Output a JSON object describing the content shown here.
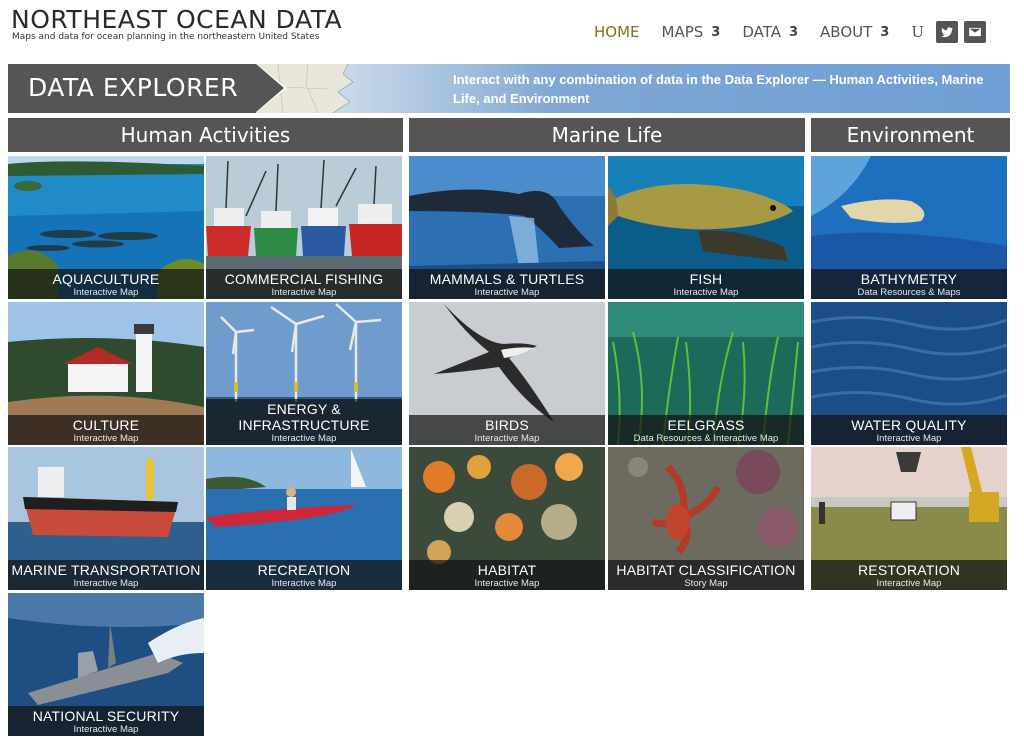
{
  "header": {
    "site_title": "NORTHEAST OCEAN DATA",
    "tagline": "Maps and data for ocean planning in the northeastern United States",
    "nav": [
      {
        "label": "HOME",
        "count": ""
      },
      {
        "label": "MAPS",
        "count": "3"
      },
      {
        "label": "DATA",
        "count": "3"
      },
      {
        "label": "ABOUT",
        "count": "3"
      }
    ],
    "user_glyph": "U",
    "social": [
      "twitter-icon",
      "email-icon"
    ]
  },
  "banner": {
    "title": "DATA EXPLORER",
    "description": "Interact with any combination of data in the Data Explorer — Human Activities, Marine Life, and Environment"
  },
  "categories": [
    "Human Activities",
    "Marine Life",
    "Environment"
  ],
  "tiles": [
    {
      "title": "AQUACULTURE",
      "subtitle": "Interactive Map"
    },
    {
      "title": "COMMERCIAL FISHING",
      "subtitle": "Interactive Map"
    },
    {
      "title": "MAMMALS & TURTLES",
      "subtitle": "Interactive Map"
    },
    {
      "title": "FISH",
      "subtitle": "Interactive Map"
    },
    {
      "title": "BATHYMETRY",
      "subtitle": "Data Resources & Maps"
    },
    {
      "title": "CULTURE",
      "subtitle": "Interactive Map"
    },
    {
      "title": "ENERGY &",
      "title2": "INFRASTRUCTURE",
      "subtitle": "Interactive Map"
    },
    {
      "title": "BIRDS",
      "subtitle": "Interactive Map"
    },
    {
      "title": "EELGRASS",
      "subtitle": "Data Resources & Interactive Map"
    },
    {
      "title": "WATER QUALITY",
      "subtitle": "Interactive Map"
    },
    {
      "title": "MARINE TRANSPORTATION",
      "subtitle": "Interactive Map"
    },
    {
      "title": "RECREATION",
      "subtitle": "Interactive Map"
    },
    {
      "title": "HABITAT",
      "subtitle": "Interactive Map"
    },
    {
      "title": "HABITAT CLASSIFICATION",
      "subtitle": "Story Map"
    },
    {
      "title": "RESTORATION",
      "subtitle": "Interactive Map"
    },
    {
      "title": "NATIONAL SECURITY",
      "subtitle": "Interactive Map"
    }
  ],
  "colors": {
    "header_gray": "#555555",
    "nav_active": "#8a6b12",
    "banner_blue": "#6e9ed4"
  }
}
